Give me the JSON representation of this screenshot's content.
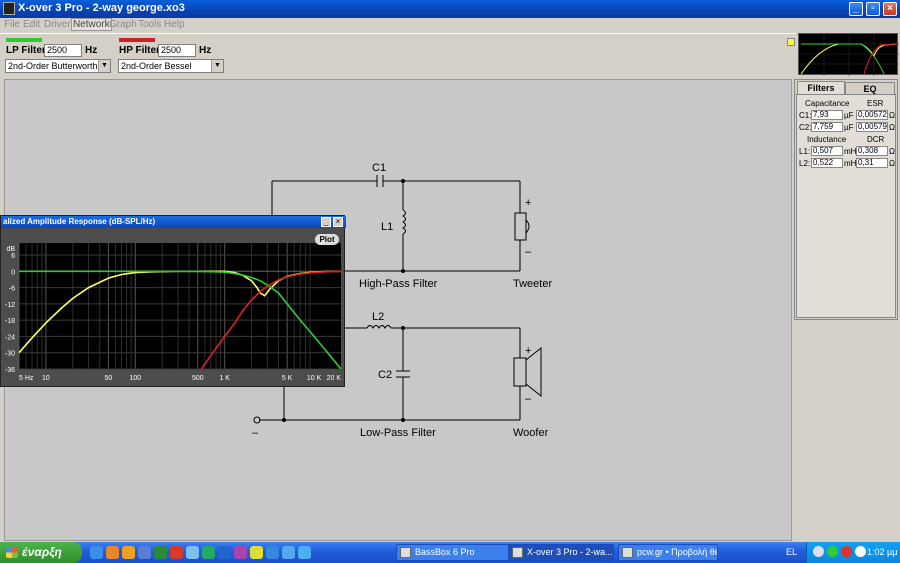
{
  "window": {
    "title": "X-over 3 Pro  -  2-way george.xo3"
  },
  "menu": {
    "items": [
      "File",
      "Edit",
      "Driver",
      "Network",
      "Graph",
      "Tools",
      "Help"
    ]
  },
  "lowpass": {
    "label": "LP Filter:",
    "freq": "2500",
    "unit": "Hz",
    "type": "2nd-Order Butterworth",
    "color": "#2dc92d"
  },
  "highpass": {
    "label": "HP Filter:",
    "freq": "2500",
    "unit": "Hz",
    "type": "2nd-Order Bessel",
    "color": "#c82222"
  },
  "schematic": {
    "c1": "C1",
    "l1": "L1",
    "l2": "L2",
    "c2": "C2",
    "hp_caption": "High-Pass Filter",
    "lp_caption": "Low-Pass Filter",
    "tweeter": "Tweeter",
    "woofer": "Woofer",
    "plus": "+",
    "minus": "–"
  },
  "panel": {
    "tabs": [
      "Filters",
      "EQ"
    ],
    "cap_header": "Capacitance",
    "esr_header": "ESR",
    "ind_header": "Inductance",
    "dcr_header": "DCR",
    "caps": [
      {
        "name": "C1:",
        "value": "7,93",
        "unit": "µF",
        "esr": "0,00572",
        "ohm": "Ω"
      },
      {
        "name": "C2:",
        "value": "7,759",
        "unit": "µF",
        "esr": "0,00579",
        "ohm": "Ω"
      }
    ],
    "inds": [
      {
        "name": "L1:",
        "value": "0,507",
        "unit": "mH",
        "dcr": "0,308",
        "ohm": "Ω"
      },
      {
        "name": "L2:",
        "value": "0,522",
        "unit": "mH",
        "dcr": "0,31",
        "ohm": "Ω"
      }
    ]
  },
  "graph": {
    "title": "alized Amplitude Response (dB-SPL/Hz)",
    "plot_button": "Plot",
    "min_button": "_",
    "close_button": "×"
  },
  "chart_data": {
    "type": "line",
    "title": "alized Amplitude Response (dB-SPL/Hz)",
    "xlabel": "",
    "ylabel": "dB",
    "x_scale": "log",
    "xlim": [
      5,
      20000
    ],
    "ylim": [
      -36,
      6
    ],
    "grid": true,
    "x_ticks": [
      "5 Hz",
      "10",
      "50",
      "100",
      "500",
      "1 K",
      "5 K",
      "10 K",
      "20 K"
    ],
    "x_tick_values": [
      5,
      10,
      50,
      100,
      500,
      1000,
      5000,
      10000,
      20000
    ],
    "y_ticks": [
      "dB",
      "6",
      "0",
      "-6",
      "-12",
      "-18",
      "-24",
      "-30",
      "-36"
    ],
    "y_tick_values": [
      6,
      0,
      -6,
      -12,
      -18,
      -24,
      -30,
      -36
    ],
    "series": [
      {
        "color": "#ffff66",
        "x": [
          5,
          7,
          10,
          15,
          20,
          30,
          50,
          70,
          100,
          150,
          200,
          300,
          500,
          700,
          1000,
          1300,
          1600,
          2000,
          2300,
          2500,
          2800,
          3200,
          4000,
          5000,
          7000,
          10000,
          15000,
          20000
        ],
        "y": [
          -30,
          -24.5,
          -19,
          -13.5,
          -10,
          -6,
          -2.5,
          -1.2,
          -0.5,
          -0.2,
          -0.1,
          0,
          0,
          0,
          0,
          -0.5,
          -1.5,
          -3.5,
          -6,
          -8,
          -9,
          -6.5,
          -3.5,
          -1.8,
          -0.8,
          -0.3,
          0,
          0
        ]
      },
      {
        "color": "#33cc33",
        "x": [
          5,
          100,
          500,
          1000,
          1500,
          2000,
          2500,
          3000,
          4000,
          5000,
          7000,
          10000,
          15000,
          20000
        ],
        "y": [
          0,
          0,
          0,
          -0.3,
          -1.2,
          -2.3,
          -3.5,
          -5,
          -8,
          -12,
          -18,
          -24,
          -31,
          -36
        ]
      },
      {
        "color": "#dd2222",
        "x": [
          550,
          700,
          1000,
          1300,
          1600,
          2000,
          2500,
          3000,
          4000,
          5000,
          7000,
          10000,
          15000,
          20000
        ],
        "y": [
          -36,
          -31,
          -24,
          -19,
          -14.5,
          -10.5,
          -7.5,
          -5.5,
          -3.2,
          -2,
          -1,
          -0.4,
          -0.1,
          0
        ]
      }
    ]
  },
  "taskbar": {
    "start": "έναρξη",
    "tasks": [
      "BassBox 6 Pro",
      "X-over 3 Pro  -  2-wa...",
      "pcw.gr • Προβολή θέ..."
    ],
    "lang": "EL",
    "clock": "1:02 μμ"
  }
}
